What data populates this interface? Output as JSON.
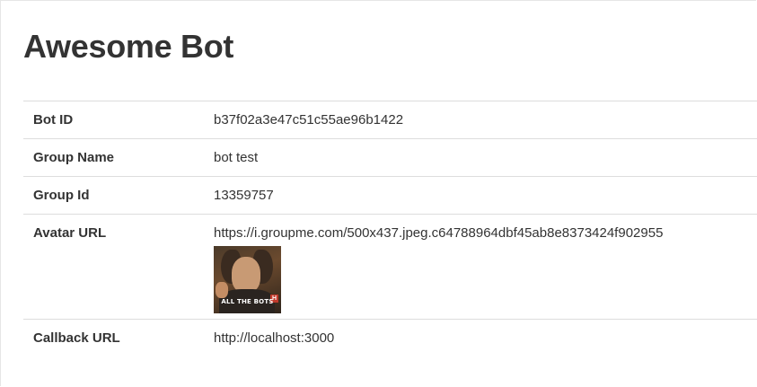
{
  "page": {
    "title": "Awesome Bot"
  },
  "details": {
    "bot_id": {
      "label": "Bot ID",
      "value": "b37f02a3e47c51c55ae96b1422"
    },
    "group_name": {
      "label": "Group Name",
      "value": "bot test"
    },
    "group_id": {
      "label": "Group Id",
      "value": "13359757"
    },
    "avatar_url": {
      "label": "Avatar URL",
      "value": "https://i.groupme.com/500x437.jpeg.c64788964dbf45ab8e8373424f902955",
      "image_caption": "ALL THE BOTS",
      "image_badge": "H"
    },
    "callback_url": {
      "label": "Callback URL",
      "value": "http://localhost:3000"
    }
  }
}
